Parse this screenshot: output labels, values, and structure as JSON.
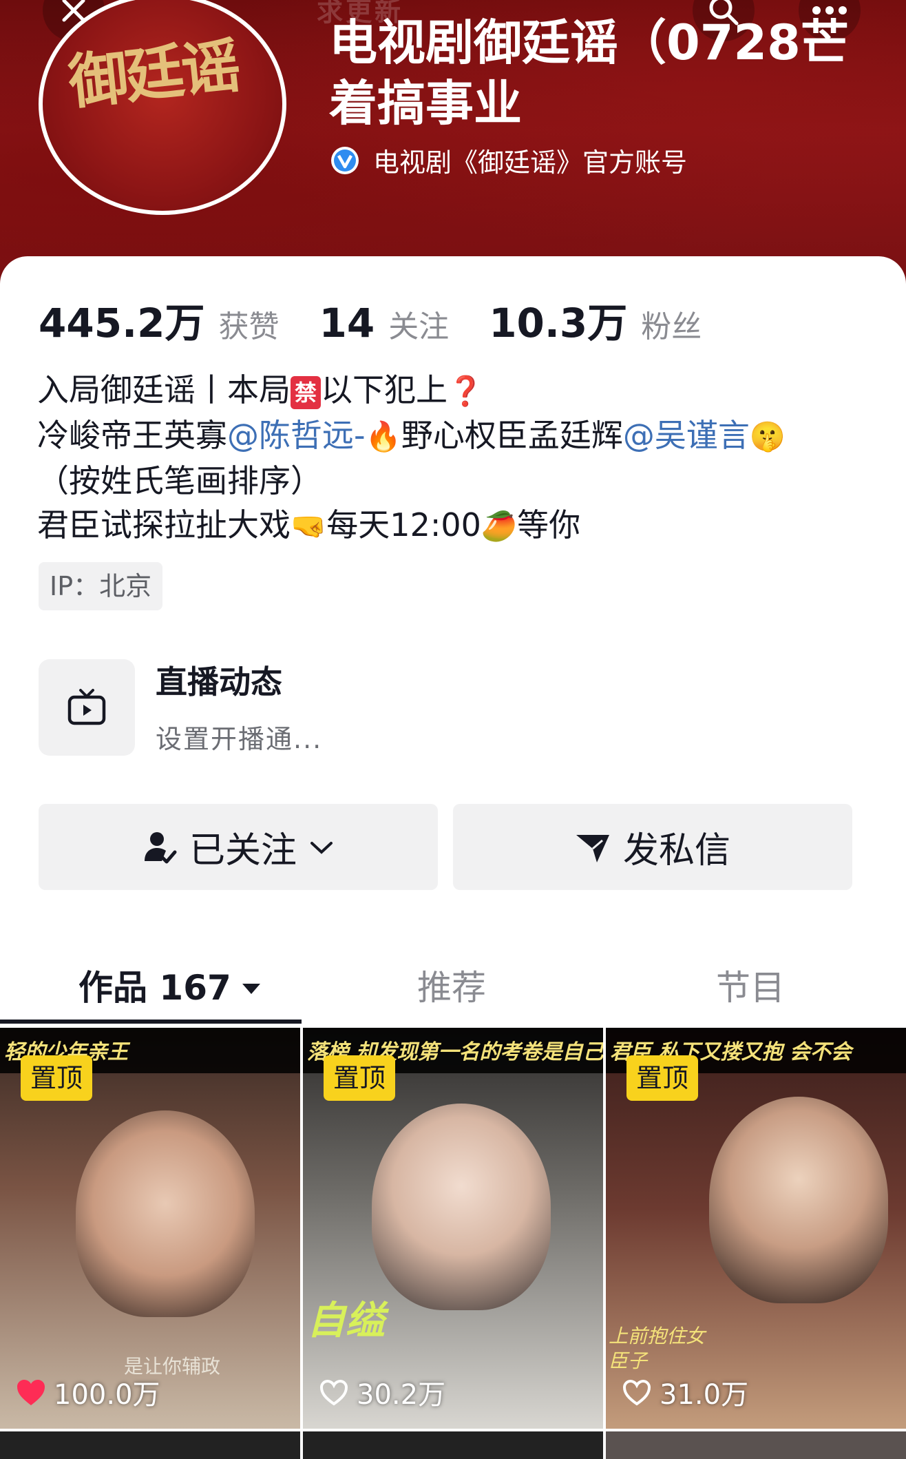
{
  "header": {
    "faint_top_text": "求更新",
    "profile_name": "电视剧御廷谣（0728芒着搞事业",
    "verified_label": "电视剧《御廷谣》官方账号",
    "avatar_text": "御廷谣",
    "icons": {
      "close": "close-icon",
      "search": "search-icon",
      "more": "more-icon"
    }
  },
  "stats": [
    {
      "value": "445.2万",
      "label": "获赞"
    },
    {
      "value": "14",
      "label": "关注"
    },
    {
      "value": "10.3万",
      "label": "粉丝"
    }
  ],
  "bio": {
    "line1_a": "入局御廷谣丨本局",
    "line1_badge": "禁",
    "line1_b": "以下犯上",
    "line1_emoji": "❓",
    "line2_a": "冷峻帝王英寡",
    "line2_mention1": "@陈哲远-",
    "line2_emoji1": "🔥",
    "line2_b": "野心权臣孟廷辉",
    "line2_mention2": "@吴谨言",
    "line2_emoji2": "🤫",
    "line3": "（按姓氏笔画排序）",
    "line4_a": "君臣试探拉扯大戏",
    "line4_emoji1": "🤜",
    "line4_b": "每天12:00",
    "line4_emoji2": "🥭",
    "line4_c": "等你"
  },
  "ip_tag": "IP：北京",
  "live": {
    "title": "直播动态",
    "subtitle": "设置开播通..."
  },
  "actions": {
    "follow_label": "已关注",
    "message_label": "发私信"
  },
  "tabs": [
    {
      "label": "作品 167",
      "active": true
    },
    {
      "label": "推荐",
      "active": false
    },
    {
      "label": "节目",
      "active": false
    }
  ],
  "videos": [
    {
      "caption": "轻的少年亲王",
      "pin": "置顶",
      "likes": "100.0万",
      "liked": true,
      "overlay_text": "是让你辅政"
    },
    {
      "caption": "落榜 却发现第一名的考卷是自己",
      "pin": "置顶",
      "likes": "30.2万",
      "liked": false,
      "overlay_text": "自缢"
    },
    {
      "caption": "君臣 私下又搂又抱 会不会",
      "pin": "置顶",
      "likes": "31.0万",
      "liked": false,
      "overlay_text": "上前抱住女臣子"
    }
  ],
  "colors": {
    "accent_red": "#e33042",
    "pin_yellow": "#f8d21d",
    "mention_blue": "#3d6fb5",
    "banner_red": "#8a1517"
  }
}
